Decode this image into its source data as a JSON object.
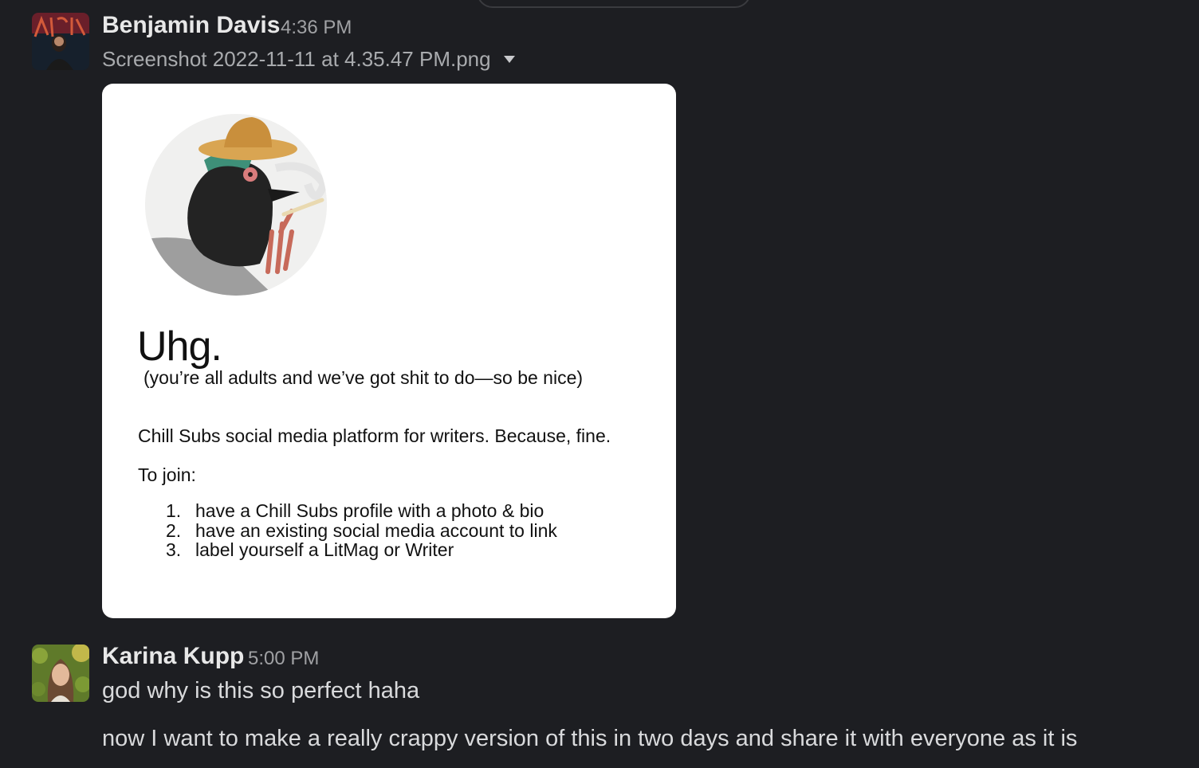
{
  "messages": [
    {
      "sender": "Benjamin Davis",
      "time": "4:36 PM",
      "attachment": {
        "filename": "Screenshot 2022-11-11 at 4.35.47 PM.png",
        "image": {
          "heading": "Uhg.",
          "subheading": "(you’re all adults and we’ve got shit to do—so be nice)",
          "intro": "Chill Subs social media platform for writers. Because, fine.",
          "join_label": "To join:",
          "steps": [
            {
              "num": "1.",
              "text": "have a Chill Subs profile with a photo & bio"
            },
            {
              "num": "2.",
              "text": "have an existing social media account to link"
            },
            {
              "num": "3.",
              "text": "label yourself a LitMag or Writer"
            }
          ]
        }
      }
    },
    {
      "sender": "Karina Kupp",
      "time": "5:00 PM",
      "lines": [
        "god why is this so perfect haha",
        "now I want to make a really crappy version of this in two days and share it with everyone as it is"
      ]
    }
  ],
  "icons": {
    "attachment_menu": "chevron-down-icon"
  },
  "colors": {
    "background": "#1d1e22",
    "sender_text": "#e8e8e8",
    "timestamp_text": "#a0a1a4",
    "message_text": "#d9dadc"
  }
}
